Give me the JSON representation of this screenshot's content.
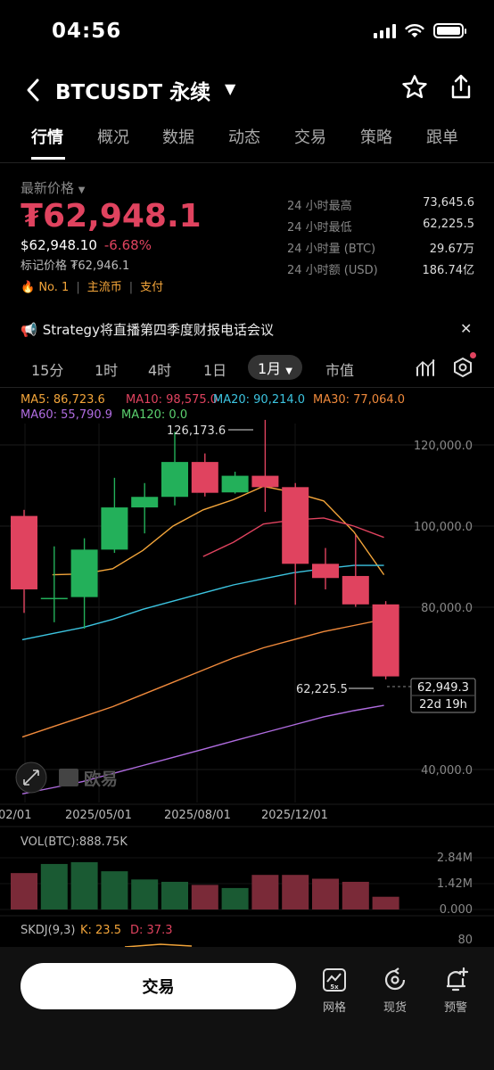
{
  "status": {
    "time": "04:56"
  },
  "header": {
    "symbol": "BTCUSDT 永续"
  },
  "tabs": [
    {
      "label": "行情"
    },
    {
      "label": "概况"
    },
    {
      "label": "数据"
    },
    {
      "label": "动态"
    },
    {
      "label": "交易"
    },
    {
      "label": "策略"
    },
    {
      "label": "跟单"
    }
  ],
  "price": {
    "label": "最新价格",
    "last": "₮62,948.1",
    "usd": "$62,948.10",
    "change": "-6.68%",
    "mark": "标记价格 ₮62,946.1",
    "tags": [
      "No. 1",
      "主流币",
      "支付"
    ]
  },
  "stats": [
    {
      "k": "24 小时最高",
      "v": "73,645.6"
    },
    {
      "k": "24 小时最低",
      "v": "62,225.5"
    },
    {
      "k": "24 小时量 (BTC)",
      "v": "29.67万"
    },
    {
      "k": "24 小时额 (USD)",
      "v": "186.74亿"
    }
  ],
  "notice": "Strategy将直播第四季度财报电话会议",
  "timeframes": [
    "15分",
    "1时",
    "4时",
    "1日",
    "1月",
    "市值"
  ],
  "colors": {
    "up": "#23b05a",
    "down": "#e0435f",
    "ma5": "#f3a53a",
    "ma10": "#e0435f",
    "ma20": "#3cc4e0",
    "ma30": "#f08a3c",
    "ma60": "#b06ce0",
    "ma120": "#5bd16f"
  },
  "chart_data": {
    "type": "candlestick",
    "ma_labels": {
      "ma5": "MA5: 86,723.6",
      "ma10": "MA10: 98,575.0",
      "ma20": "MA20: 90,214.0",
      "ma30": "MA30: 77,064.0",
      "ma60": "MA60: 55,790.9",
      "ma120": "MA120: 0.0"
    },
    "y_ticks": [
      "120,000.0",
      "100,000.0",
      "80,000.0",
      "40,000.0"
    ],
    "y_tick_values": [
      120000,
      100000,
      80000,
      40000
    ],
    "x_ticks": [
      "02/01",
      "2025/05/01",
      "2025/08/01",
      "2025/12/01"
    ],
    "high_label": "126,173.6",
    "low_label": "62,225.5",
    "current_price": "62,949.3",
    "countdown": "22d 19h",
    "watermark": "欧易",
    "candles": [
      {
        "o": 102500,
        "c": 84400,
        "h": 104000,
        "l": 78600
      },
      {
        "o": 82300,
        "c": 82300,
        "h": 95000,
        "l": 76300
      },
      {
        "o": 82500,
        "c": 94200,
        "h": 97000,
        "l": 74700
      },
      {
        "o": 94200,
        "c": 104600,
        "h": 111900,
        "l": 93400
      },
      {
        "o": 104600,
        "c": 107200,
        "h": 110600,
        "l": 98200
      },
      {
        "o": 107200,
        "c": 115800,
        "h": 123200,
        "l": 105100
      },
      {
        "o": 115800,
        "c": 108200,
        "h": 117900,
        "l": 107300
      },
      {
        "o": 108300,
        "c": 112400,
        "h": 113400,
        "l": 108000
      },
      {
        "o": 112400,
        "c": 109600,
        "h": 126173.6,
        "l": 103500
      },
      {
        "o": 109600,
        "c": 90700,
        "h": 110600,
        "l": 80600
      },
      {
        "o": 90700,
        "c": 87200,
        "h": 94600,
        "l": 84400
      },
      {
        "o": 87700,
        "c": 80700,
        "h": 97800,
        "l": 80100
      },
      {
        "o": 80700,
        "c": 62949.3,
        "h": 81500,
        "l": 62225.5
      }
    ],
    "ma_series": {
      "ma5": [
        null,
        88000,
        88200,
        89500,
        94000,
        100000,
        104000,
        106500,
        109800,
        108300,
        106200,
        98600,
        88000
      ],
      "ma10": [
        null,
        null,
        null,
        null,
        null,
        null,
        92500,
        96000,
        100500,
        101500,
        102000,
        100000,
        97200
      ],
      "ma20": [
        72000,
        73500,
        75000,
        77000,
        79500,
        81500,
        83500,
        85500,
        87000,
        88500,
        89500,
        90300,
        90300
      ],
      "ma30": [
        48000,
        50500,
        53000,
        55500,
        58500,
        61500,
        64500,
        67500,
        70000,
        72000,
        74000,
        75500,
        77000
      ],
      "ma60": [
        34000,
        35500,
        37000,
        39000,
        41000,
        43000,
        45000,
        47000,
        49000,
        51000,
        53000,
        54500,
        55800
      ]
    },
    "volume": {
      "label": "VOL(BTC):888.75K",
      "y_ticks": [
        "2.84M",
        "1.42M",
        "0.000"
      ],
      "y_tick_values": [
        2840000,
        1420000,
        0
      ],
      "values": [
        2000000,
        2500000,
        2600000,
        2100000,
        1650000,
        1520000,
        1350000,
        1180000,
        1900000,
        1900000,
        1690000,
        1520000,
        700000
      ]
    },
    "skdj": {
      "label": "SKDJ(9,3)",
      "k": "K: 23.5",
      "d": "D: 37.3",
      "y_tick": "80"
    }
  },
  "bottom": {
    "trade": "交易",
    "items": [
      {
        "label": "网格",
        "icon": "grid-chart-icon"
      },
      {
        "label": "现货",
        "icon": "spot-swap-icon"
      },
      {
        "label": "预警",
        "icon": "alert-bell-icon"
      }
    ]
  }
}
